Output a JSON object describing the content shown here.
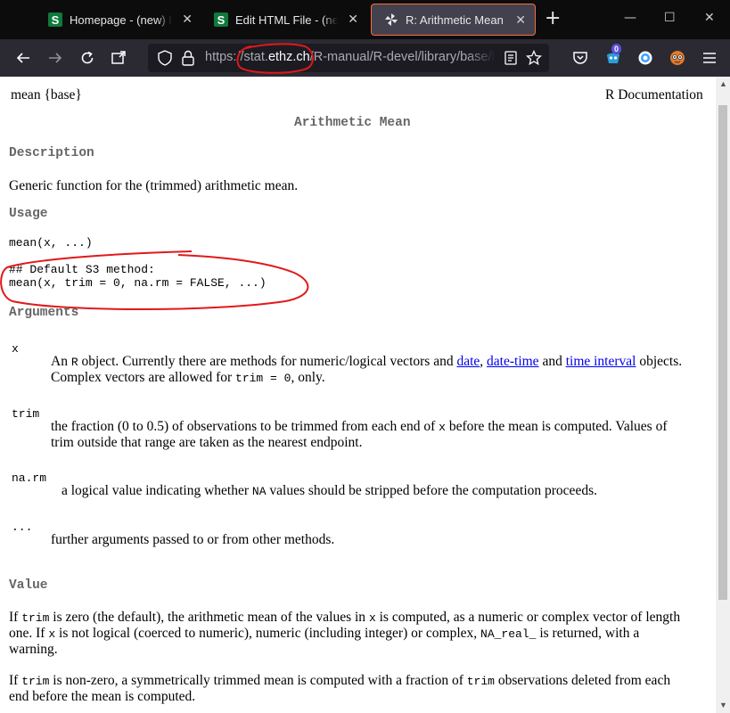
{
  "browser": {
    "tabs": [
      {
        "label": "Homepage - (new) Programiz",
        "favicon": "S"
      },
      {
        "label": "Edit HTML File - (new) Programiz",
        "favicon": "S"
      },
      {
        "label": "R: Arithmetic Mean",
        "favicon": "pinwheel"
      }
    ],
    "url": {
      "prefix": "https://",
      "domain_pre": "stat.",
      "domain": "ethz.ch",
      "path": "/R-manual/R-devel/library/base/html/mean.html"
    },
    "profile_badge": "0"
  },
  "doc": {
    "topic": "mean {base}",
    "doc_label": "R Documentation",
    "title": "Arithmetic Mean",
    "description_heading": "Description",
    "description": "Generic function for the (trimmed) arithmetic mean.",
    "usage_heading": "Usage",
    "usage_generic": "mean(x, ...)",
    "usage_comment": "## Default S3 method:",
    "usage_default": "mean(x, trim = 0, na.rm = FALSE, ...)",
    "arguments_heading": "Arguments",
    "args": {
      "x": {
        "name": "x",
        "t1": "An",
        "t1_code": "R",
        "t2": "object. Currently there are methods for numeric/logical vectors and",
        "link1": "date",
        "link2": "date-time",
        "t_and": "and",
        "link3": "time interval",
        "t3": "objects.",
        "t4": "Complex vectors are allowed for",
        "t4_code": "trim = 0",
        "t5": ", only."
      },
      "trim": {
        "name": "trim",
        "t1": "the fraction (0 to 0.5) of observations to be trimmed from each end of",
        "t1_code": "x",
        "t2": "before the mean is computed. Values of",
        "t3": "trim outside that range are taken as the nearest endpoint."
      },
      "narm": {
        "name": "na.rm",
        "t1": "a logical value indicating whether",
        "t1_code": "NA",
        "t2": "values should be stripped before the computation proceeds."
      },
      "dots": {
        "name": "...",
        "t1": "further arguments passed to or from other methods."
      }
    },
    "value_heading": "Value",
    "value1": {
      "a": "If",
      "a_code": "trim",
      "b": "is zero (the default), the arithmetic mean of the values in",
      "b_code": "x",
      "c": "is computed, as a numeric or complex vector of length",
      "d": "one. If",
      "d_code": "x",
      "e": "is not logical (coerced to numeric), numeric (including integer) or complex,",
      "e_code": "NA_real_",
      "f": "is returned, with a",
      "g": "warning."
    },
    "value2": {
      "a": "If",
      "a_code": "trim",
      "b": "is non-zero, a symmetrically trimmed mean is computed with a fraction of",
      "b_code": "trim",
      "c": "observations deleted from each",
      "d": "end before the mean is computed."
    }
  },
  "colors": {
    "tabbar": "#0c0c0d",
    "toolbar": "#2b2a33",
    "heading": "#666666",
    "link": "#0000ee",
    "annotation": "#e0191b"
  }
}
